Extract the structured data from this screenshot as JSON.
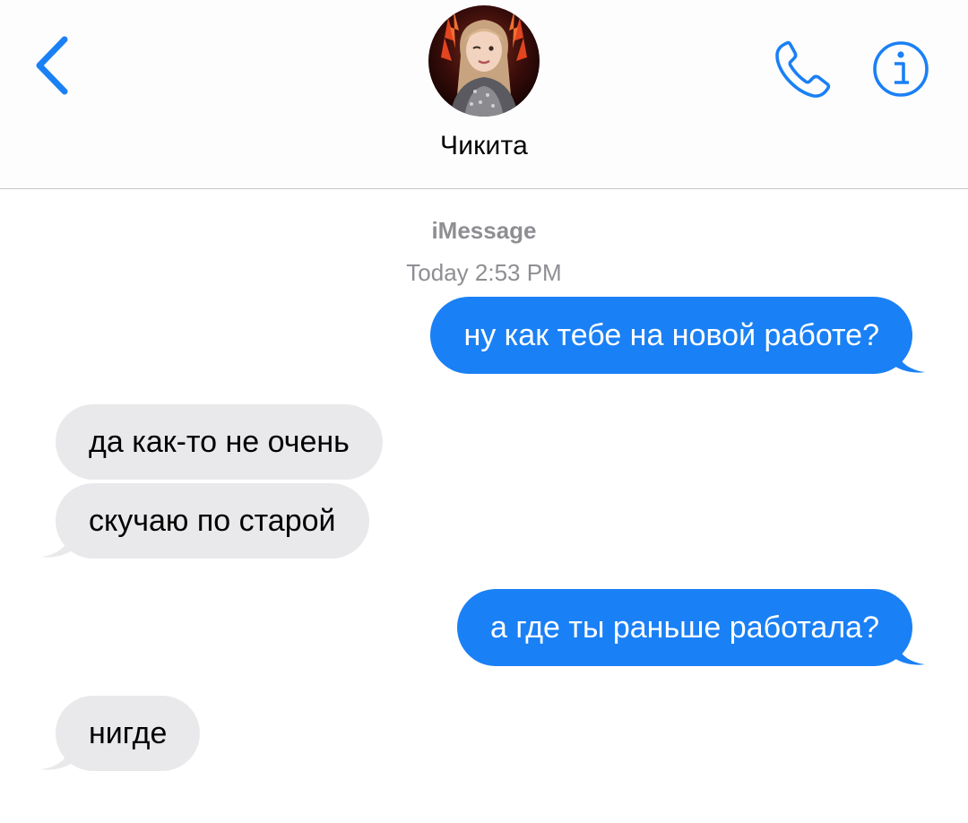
{
  "header": {
    "contact_name": "Чикита",
    "avatar_alt": "avatar",
    "back_icon": "chevron-left-icon",
    "call_icon": "phone-icon",
    "info_icon": "info-icon"
  },
  "conversation": {
    "service": "iMessage",
    "timestamp": "Today 2:53 PM",
    "messages": [
      {
        "direction": "outgoing",
        "text": "ну как тебе на новой работе?"
      },
      {
        "direction": "incoming",
        "text": "да как-то не очень"
      },
      {
        "direction": "incoming",
        "text": "скучаю по старой"
      },
      {
        "direction": "outgoing",
        "text": "а где ты раньше работала?"
      },
      {
        "direction": "incoming",
        "text": "нигде"
      }
    ]
  },
  "colors": {
    "accent": "#1a80f5",
    "incoming_bubble": "#e9e9eb",
    "secondary_text": "#8e8e93"
  }
}
